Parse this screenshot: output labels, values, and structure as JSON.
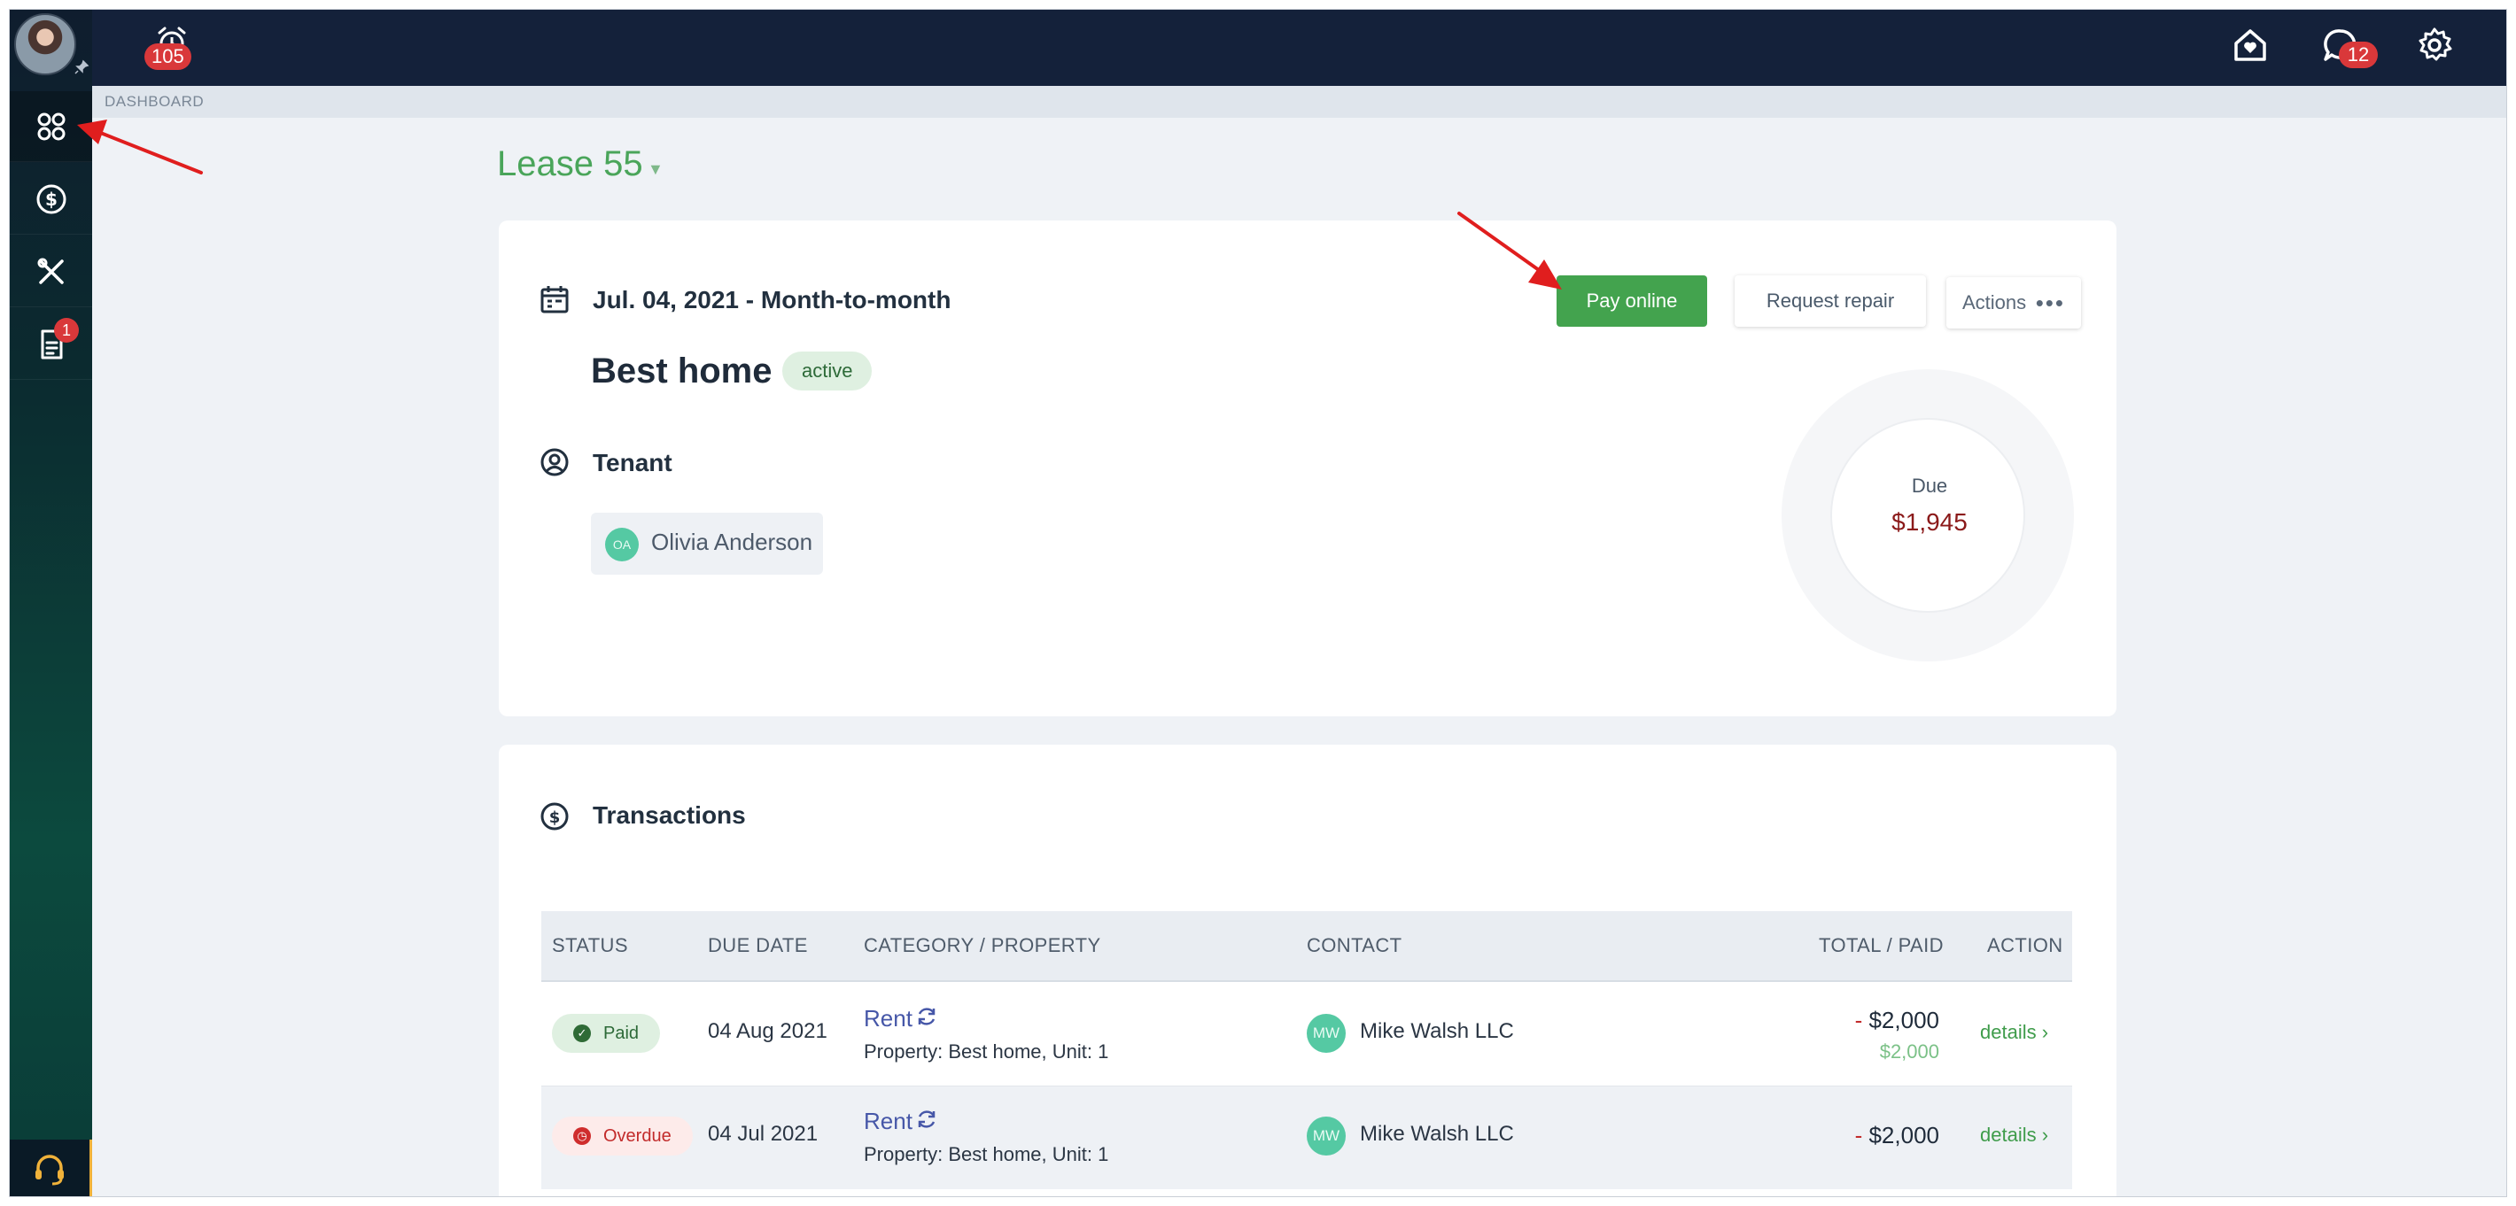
{
  "topbar": {
    "alarm_badge": "105",
    "chat_badge": "12"
  },
  "sidebar": {
    "items": [
      {
        "name": "dashboard",
        "icon": "grid-icon"
      },
      {
        "name": "payments",
        "icon": "dollar-circle-icon"
      },
      {
        "name": "repairs",
        "icon": "tools-icon"
      },
      {
        "name": "documents",
        "icon": "document-icon",
        "badge": "1"
      }
    ],
    "support_icon": "headset-icon"
  },
  "breadcrumb": "DASHBOARD",
  "lease": {
    "title": "Lease 55",
    "date_range": "Jul. 04, 2021 - Month-to-month",
    "property_name": "Best home",
    "status": "active",
    "tenant_label": "Tenant",
    "tenant": {
      "initials": "OA",
      "name": "Olivia Anderson"
    },
    "buttons": {
      "pay_online": "Pay online",
      "request_repair": "Request repair",
      "actions": "Actions"
    },
    "due_label": "Due",
    "due_value": "$1,945"
  },
  "transactions": {
    "title": "Transactions",
    "columns": [
      "STATUS",
      "DUE DATE",
      "CATEGORY / PROPERTY",
      "CONTACT",
      "TOTAL / PAID",
      "ACTION"
    ],
    "rows": [
      {
        "status": "Paid",
        "due_date": "04 Aug 2021",
        "category": "Rent",
        "property": "Property: Best home, Unit: 1",
        "contact_initials": "MW",
        "contact": "Mike Walsh LLC",
        "total_sign": "- ",
        "total": "$2,000",
        "paid": "$2,000",
        "action": "details ›"
      },
      {
        "status": "Overdue",
        "due_date": "04 Jul 2021",
        "category": "Rent",
        "property": "Property: Best home, Unit: 1",
        "contact_initials": "MW",
        "contact": "Mike Walsh LLC",
        "total_sign": "- ",
        "total": "$2,000",
        "action": "details ›"
      }
    ]
  },
  "colors": {
    "accent_green": "#43a34e",
    "topbar": "#14213a",
    "badge_red": "#d9383a",
    "due_red": "#8b1a1a"
  }
}
